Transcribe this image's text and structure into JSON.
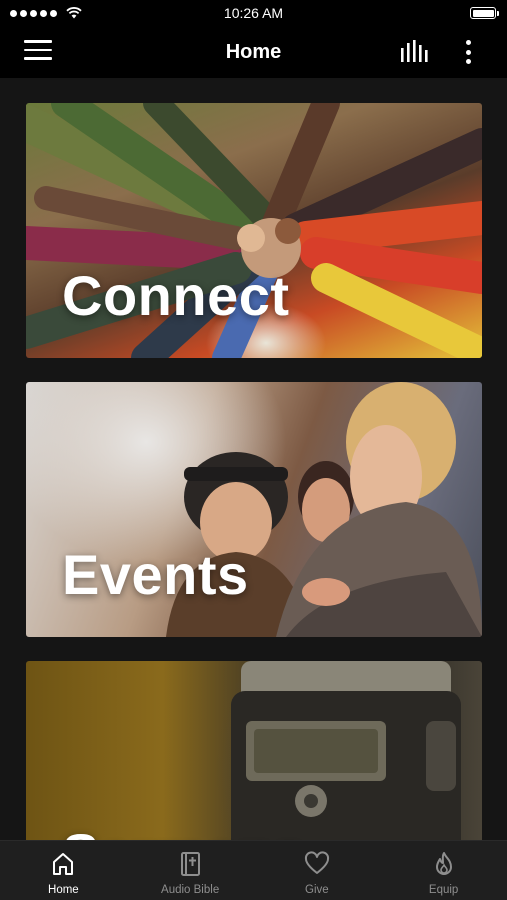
{
  "status_bar": {
    "time": "10:26 AM"
  },
  "nav": {
    "title": "Home",
    "icons": [
      "menu-icon",
      "stats-icon",
      "more-icon"
    ]
  },
  "cards": [
    {
      "label": "Connect"
    },
    {
      "label": "Events"
    },
    {
      "label": "Sermons"
    }
  ],
  "tabs": [
    {
      "label": "Home",
      "icon": "home-icon",
      "active": true
    },
    {
      "label": "Audio Bible",
      "icon": "bible-icon",
      "active": false
    },
    {
      "label": "Give",
      "icon": "heart-icon",
      "active": false
    },
    {
      "label": "Equip",
      "icon": "flame-icon",
      "active": false
    }
  ],
  "colors": {
    "background": "#151515",
    "bar": "#000000",
    "tab_bar": "#1f1f1f",
    "tab_inactive": "#8e8e8e",
    "tab_active": "#ffffff"
  }
}
